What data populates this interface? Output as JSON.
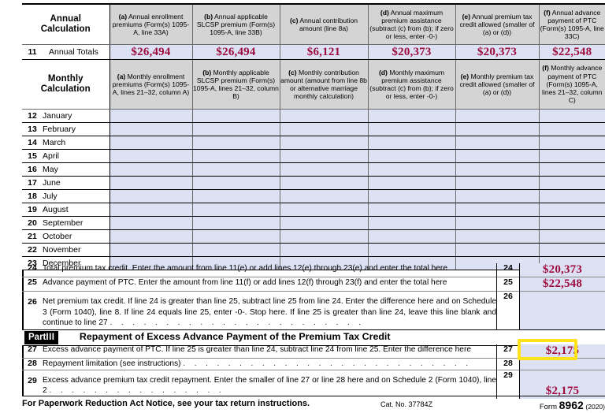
{
  "form": {
    "number": "8962",
    "year": "(2020)",
    "catalog": "Cat. No. 37784Z",
    "paperwork_notice": "For Paperwork Reduction Act Notice, see your tax return instructions.",
    "form_label": "Form"
  },
  "annual": {
    "row_label_line1": "Annual",
    "row_label_line2": "Calculation",
    "columns": [
      {
        "key": "(a)",
        "text": "Annual enrollment premiums (Form(s) 1095-A, line 33A)"
      },
      {
        "key": "(b)",
        "text": "Annual applicable SLCSP premium (Form(s) 1095-A, line 33B)"
      },
      {
        "key": "(c)",
        "text": "Annual contribution amount (line 8a)"
      },
      {
        "key": "(d)",
        "text": "Annual maximum premium assistance (subtract (c) from (b); if zero or less, enter -0-)"
      },
      {
        "key": "(e)",
        "text": "Annual premium tax credit allowed (smaller of (a) or (d))"
      },
      {
        "key": "(f)",
        "text": "Annual advance payment of PTC (Form(s) 1095-A, line 33C)"
      }
    ],
    "totals_row": {
      "number": "11",
      "label": "Annual Totals",
      "values": [
        "$26,494",
        "$26,494",
        "$6,121",
        "$20,373",
        "$20,373",
        "$22,548"
      ]
    }
  },
  "monthly": {
    "row_label_line1": "Monthly",
    "row_label_line2": "Calculation",
    "columns": [
      {
        "key": "(a)",
        "text": "Monthly enrollment premiums (Form(s) 1095-A, lines 21–32, column A)"
      },
      {
        "key": "(b)",
        "text": "Monthly applicable SLCSP premium (Form(s) 1095-A, lines 21–32, column B)"
      },
      {
        "key": "(c)",
        "text": "Monthly contribution amount (amount from line 8b or alternative marriage monthly calculation)"
      },
      {
        "key": "(d)",
        "text": "Monthly maximum premium assistance (subtract (c) from (b); if zero or less, enter -0-)"
      },
      {
        "key": "(e)",
        "text": "Monthly premium tax credit allowed (smaller of (a) or (d))"
      },
      {
        "key": "(f)",
        "text": "Monthly advance payment of PTC (Form(s) 1095-A, lines 21–32, column C)"
      }
    ],
    "rows": [
      {
        "number": "12",
        "month": "January",
        "values": [
          "",
          "",
          "",
          "",
          "",
          ""
        ]
      },
      {
        "number": "13",
        "month": "February",
        "values": [
          "",
          "",
          "",
          "",
          "",
          ""
        ]
      },
      {
        "number": "14",
        "month": "March",
        "values": [
          "",
          "",
          "",
          "",
          "",
          ""
        ]
      },
      {
        "number": "15",
        "month": "April",
        "values": [
          "",
          "",
          "",
          "",
          "",
          ""
        ]
      },
      {
        "number": "16",
        "month": "May",
        "values": [
          "",
          "",
          "",
          "",
          "",
          ""
        ]
      },
      {
        "number": "17",
        "month": "June",
        "values": [
          "",
          "",
          "",
          "",
          "",
          ""
        ]
      },
      {
        "number": "18",
        "month": "July",
        "values": [
          "",
          "",
          "",
          "",
          "",
          ""
        ]
      },
      {
        "number": "19",
        "month": "August",
        "values": [
          "",
          "",
          "",
          "",
          "",
          ""
        ]
      },
      {
        "number": "20",
        "month": "September",
        "values": [
          "",
          "",
          "",
          "",
          "",
          ""
        ]
      },
      {
        "number": "21",
        "month": "October",
        "values": [
          "",
          "",
          "",
          "",
          "",
          ""
        ]
      },
      {
        "number": "22",
        "month": "November",
        "values": [
          "",
          "",
          "",
          "",
          "",
          ""
        ]
      },
      {
        "number": "23",
        "month": "December",
        "values": [
          "",
          "",
          "",
          "",
          "",
          ""
        ]
      }
    ]
  },
  "lines": {
    "l24": {
      "number": "24",
      "box": "24",
      "text": "Total premium tax credit. Enter the amount from line 11(e) or add lines 12(e) through 23(e) and enter the total here",
      "value": "$20,373"
    },
    "l25": {
      "number": "25",
      "box": "25",
      "text": "Advance payment of PTC. Enter the amount from line 11(f) or add lines 12(f) through 23(f) and enter the total here",
      "value": "$22,548"
    },
    "l26": {
      "number": "26",
      "box": "26",
      "text": "Net premium tax credit. If line 24 is greater than line 25, subtract line 25 from line 24. Enter the difference here and on Schedule 3 (Form 1040), line 8. If line 24 equals line 25, enter -0-. Stop here. If line 25 is greater than line 24, leave this line blank and continue to line 27",
      "value": ""
    },
    "l27": {
      "number": "27",
      "box": "27",
      "text": "Excess advance payment of PTC. If line 25 is greater than line 24, subtract line 24 from line 25. Enter the difference here",
      "value": "$2,175"
    },
    "l28": {
      "number": "28",
      "box": "28",
      "text": "Repayment limitation (see instructions)",
      "value": ""
    },
    "l29": {
      "number": "29",
      "box": "29",
      "text": "Excess advance premium tax credit repayment. Enter the smaller of line 27 or line 28 here and on Schedule 2 (Form 1040), line 2",
      "value": "$2,175"
    }
  },
  "part3": {
    "part_word": "Part",
    "part_numeral": "III",
    "title": "Repayment of Excess Advance Payment of the Premium Tax Credit"
  },
  "colors": {
    "entry_fill": "#dde1f4",
    "header_fill": "#d4d4d4",
    "value_text": "#9e0c3d",
    "highlight": "#ffe21a"
  }
}
